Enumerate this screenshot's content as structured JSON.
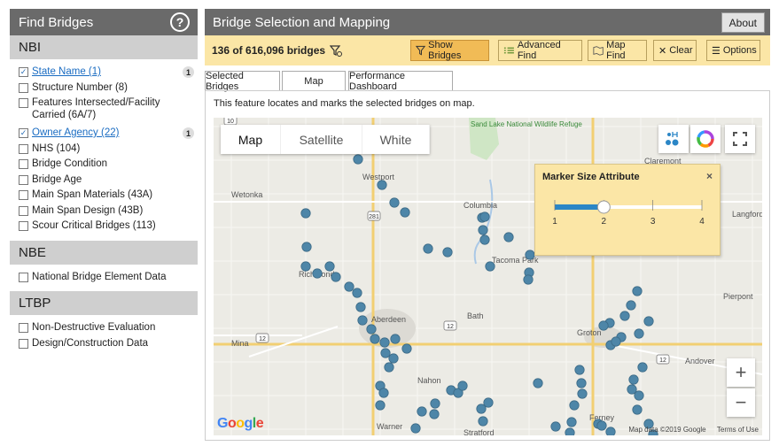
{
  "left": {
    "title": "Find Bridges",
    "help_icon": "?",
    "sections": [
      {
        "name": "NBI",
        "items": [
          {
            "label": "State Name (1)",
            "checked": true,
            "link": true,
            "badge": "1"
          },
          {
            "label": "Structure Number (8)",
            "checked": false
          },
          {
            "label": "Features Intersected/Facility Carried (6A/7)",
            "checked": false,
            "two_line": true
          },
          {
            "label": "Owner Agency (22)",
            "checked": true,
            "link": true,
            "badge": "1"
          },
          {
            "label": "NHS (104)",
            "checked": false
          },
          {
            "label": "Bridge Condition",
            "checked": false
          },
          {
            "label": "Bridge Age",
            "checked": false
          },
          {
            "label": "Main Span Materials (43A)",
            "checked": false
          },
          {
            "label": "Main Span Design (43B)",
            "checked": false
          },
          {
            "label": "Scour Critical Bridges (113)",
            "checked": false
          }
        ]
      },
      {
        "name": "NBE",
        "items": [
          {
            "label": "National Bridge Element Data",
            "checked": false
          }
        ]
      },
      {
        "name": "LTBP",
        "items": [
          {
            "label": "Non-Destructive Evaluation",
            "checked": false
          },
          {
            "label": "Design/Construction Data",
            "checked": false
          }
        ]
      }
    ]
  },
  "main": {
    "title": "Bridge Selection and Mapping",
    "about": "About",
    "count": "136 of 616,096 bridges",
    "buttons": {
      "show": "Show Bridges",
      "advanced": "Advanced Find",
      "mapfind": "Map Find",
      "clear": "Clear",
      "options": "Options"
    },
    "tabs": [
      "Selected Bridges",
      "Map",
      "Performance Dashboard"
    ],
    "selected_tab": "Map",
    "description": "This feature locates and marks the selected bridges on map.",
    "map_types": [
      "Map",
      "Satellite",
      "White"
    ],
    "popup": {
      "title": "Marker Size Attribute",
      "close": "×",
      "ticks": [
        "1",
        "2",
        "3",
        "4"
      ],
      "value": 2
    },
    "zoom_in": "+",
    "zoom_out": "−",
    "google": "Google",
    "map_data": "Map data ©2019 Google",
    "terms": "Terms of Use",
    "place_labels": [
      "Westport",
      "Wetonka",
      "Columbia",
      "Richmond",
      "Aberdeen",
      "Bath",
      "Mina",
      "Groton",
      "Nahon",
      "Warner",
      "Stratford",
      "Ferney",
      "Andover",
      "Pierpont",
      "Langford",
      "Claremont",
      "Tacoma Park",
      "Sand Lake National Wildlife Refuge"
    ],
    "road_labels": [
      "10",
      "281",
      "12",
      "12",
      "12",
      "10"
    ],
    "accent": "#2b86c6",
    "marker_color": "#4e86a8"
  }
}
